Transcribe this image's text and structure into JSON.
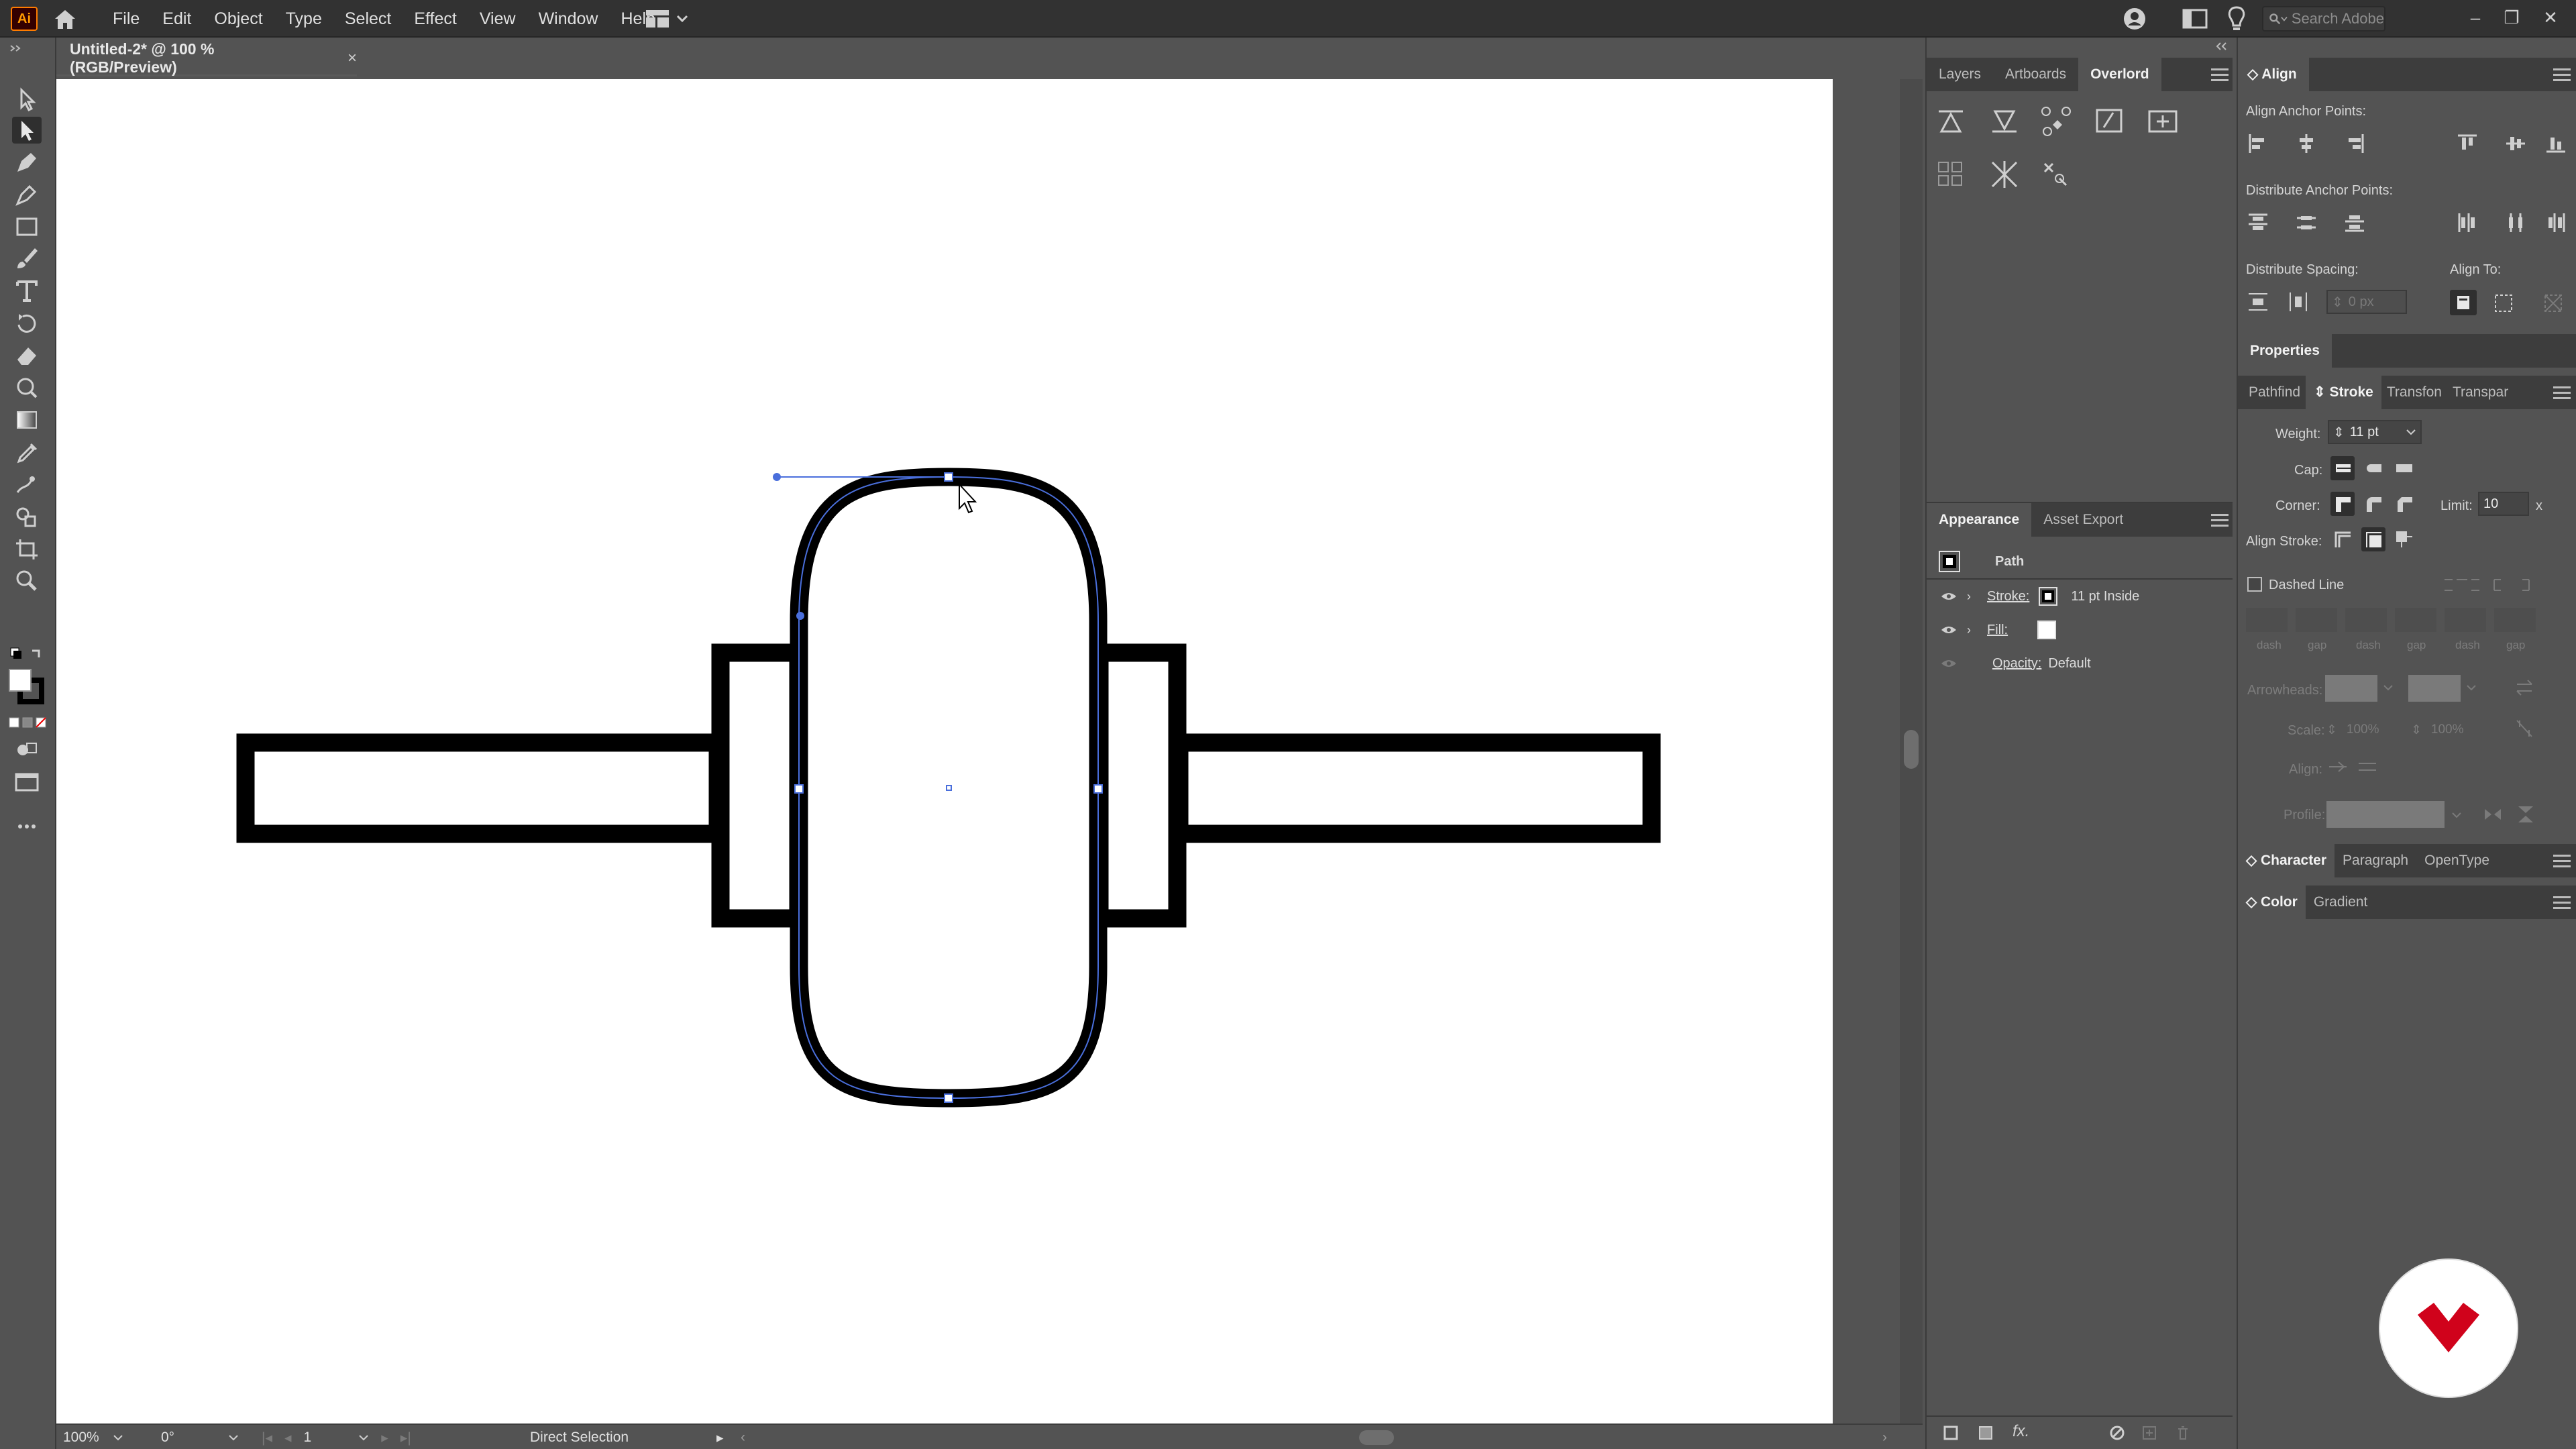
{
  "app": {
    "logo_text": "Ai",
    "menu": [
      "File",
      "Edit",
      "Object",
      "Type",
      "Select",
      "Effect",
      "View",
      "Window",
      "Help"
    ],
    "search_placeholder": "Search Adobe"
  },
  "document": {
    "tab_title": "Untitled-2* @ 100 % (RGB/Preview)",
    "tab_close": "×"
  },
  "status": {
    "zoom": "100%",
    "rotation": "0°",
    "artboard": "1",
    "tool": "Direct Selection"
  },
  "layers_panel": {
    "tabs": [
      "Layers",
      "Artboards",
      "Overlord"
    ],
    "active_tab": "Overlord"
  },
  "appearance_panel": {
    "tabs": [
      "Appearance",
      "Asset Export"
    ],
    "object_type": "Path",
    "stroke_label": "Stroke:",
    "stroke_value": "11 pt  Inside",
    "fill_label": "Fill:",
    "opacity_label": "Opacity:",
    "opacity_value": "Default"
  },
  "align_panel": {
    "title": "Align",
    "anchor_points_label": "Align Anchor Points:",
    "distribute_anchor_label": "Distribute Anchor Points:",
    "distribute_spacing_label": "Distribute Spacing:",
    "align_to_label": "Align To:",
    "spacing_value": "0 px"
  },
  "properties_panel": {
    "title": "Properties"
  },
  "stroke_panel": {
    "tabs": [
      "Pathfind",
      "Stroke",
      "Transfon",
      "Transpar"
    ],
    "weight_label": "Weight:",
    "weight_value": "11 pt",
    "cap_label": "Cap:",
    "corner_label": "Corner:",
    "limit_label": "Limit:",
    "limit_value": "10",
    "limit_unit": "x",
    "align_stroke_label": "Align Stroke:",
    "dashed_line_label": "Dashed Line",
    "dash_labels": [
      "dash",
      "gap",
      "dash",
      "gap",
      "dash",
      "gap"
    ],
    "arrowheads_label": "Arrowheads:",
    "scale_label": "Scale:",
    "scale_value_1": "100%",
    "scale_value_2": "100%",
    "align_label": "Align:",
    "profile_label": "Profile:"
  },
  "character_panel": {
    "tabs": [
      "Character",
      "Paragraph",
      "OpenType"
    ]
  },
  "color_panel": {
    "tabs": [
      "Color",
      "Gradient"
    ]
  },
  "colors": {
    "ui_bg": "#535353",
    "menubar": "#323232",
    "selection_blue": "#4a6fdc",
    "brand_red": "#d0021b"
  }
}
